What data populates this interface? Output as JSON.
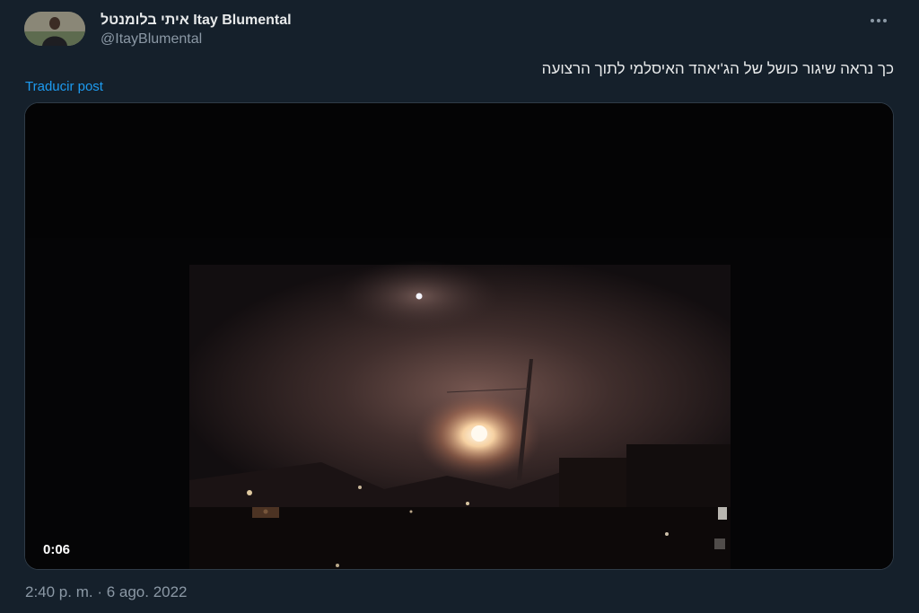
{
  "tweet": {
    "author": {
      "display_name": "איתי בלומנטל Itay Blumental",
      "handle": "@ItayBlumental",
      "avatar_icon": "person-photo-avatar"
    },
    "more_icon": "more-horizontal-icon",
    "text": "כך נראה שיגור כושל של הג'יאהד האיסלמי לתוך הרצועה",
    "translate_label": "Traducir post",
    "media": {
      "type": "video",
      "duration": "0:06"
    },
    "timestamp": "2:40 p. m. · 6 ago. 2022"
  },
  "colors": {
    "background": "#15202b",
    "text_primary": "#e7e9ea",
    "text_secondary": "#8b98a5",
    "link": "#1d9bf0"
  }
}
